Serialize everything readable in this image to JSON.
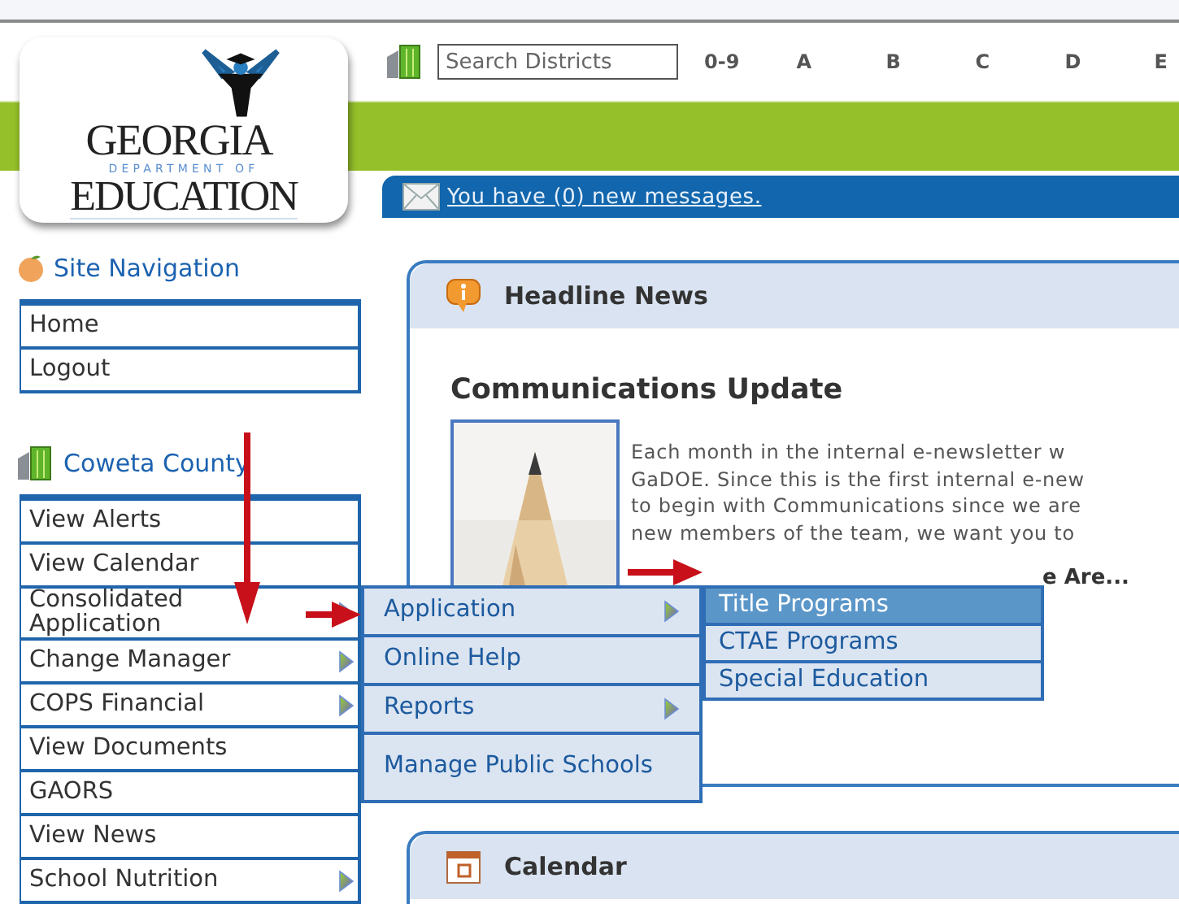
{
  "header": {
    "logo": {
      "title": "GEORGIA",
      "subtitle": "DEPARTMENT OF",
      "name": "EDUCATION"
    },
    "search": {
      "placeholder": "Search Districts"
    },
    "index_links": [
      "0-9",
      "A",
      "B",
      "C",
      "D",
      "E"
    ],
    "message_link": "You have (0) new messages."
  },
  "site_navigation": {
    "title": "Site Navigation",
    "items": [
      {
        "label": "Home"
      },
      {
        "label": "Logout"
      }
    ]
  },
  "district_menu": {
    "title": "Coweta County",
    "items": [
      {
        "label": "View Alerts",
        "submenu": false
      },
      {
        "label": "View Calendar",
        "submenu": false
      },
      {
        "label": "Consolidated Application",
        "submenu": true
      },
      {
        "label": "Change Manager",
        "submenu": true
      },
      {
        "label": "COPS Financial",
        "submenu": true
      },
      {
        "label": "View Documents",
        "submenu": false
      },
      {
        "label": "GAORS",
        "submenu": false
      },
      {
        "label": "View News",
        "submenu": false
      },
      {
        "label": "School Nutrition",
        "submenu": true
      }
    ]
  },
  "headline_news": {
    "title": "Headline News",
    "article_title": "Communications Update",
    "paragraph": [
      "Each month in the internal e-newsletter w",
      "GaDOE. Since this is the first internal e-new",
      "to begin with Communications since we are",
      "new members of the team, we want you to"
    ],
    "subheading": "e Are..."
  },
  "calendar": {
    "title": "Calendar"
  },
  "flyout_menu": {
    "items": [
      {
        "label": "Application",
        "submenu": true,
        "selected": false
      },
      {
        "label": "Online Help",
        "submenu": false,
        "selected": false
      },
      {
        "label": "Reports",
        "submenu": true,
        "selected": false
      },
      {
        "label": "Manage Public Schools",
        "submenu": false,
        "selected": false
      }
    ]
  },
  "submenu": {
    "items": [
      {
        "label": "Title Programs",
        "selected": true
      },
      {
        "label": "CTAE Programs",
        "selected": false
      },
      {
        "label": "Special Education",
        "selected": false
      }
    ]
  }
}
